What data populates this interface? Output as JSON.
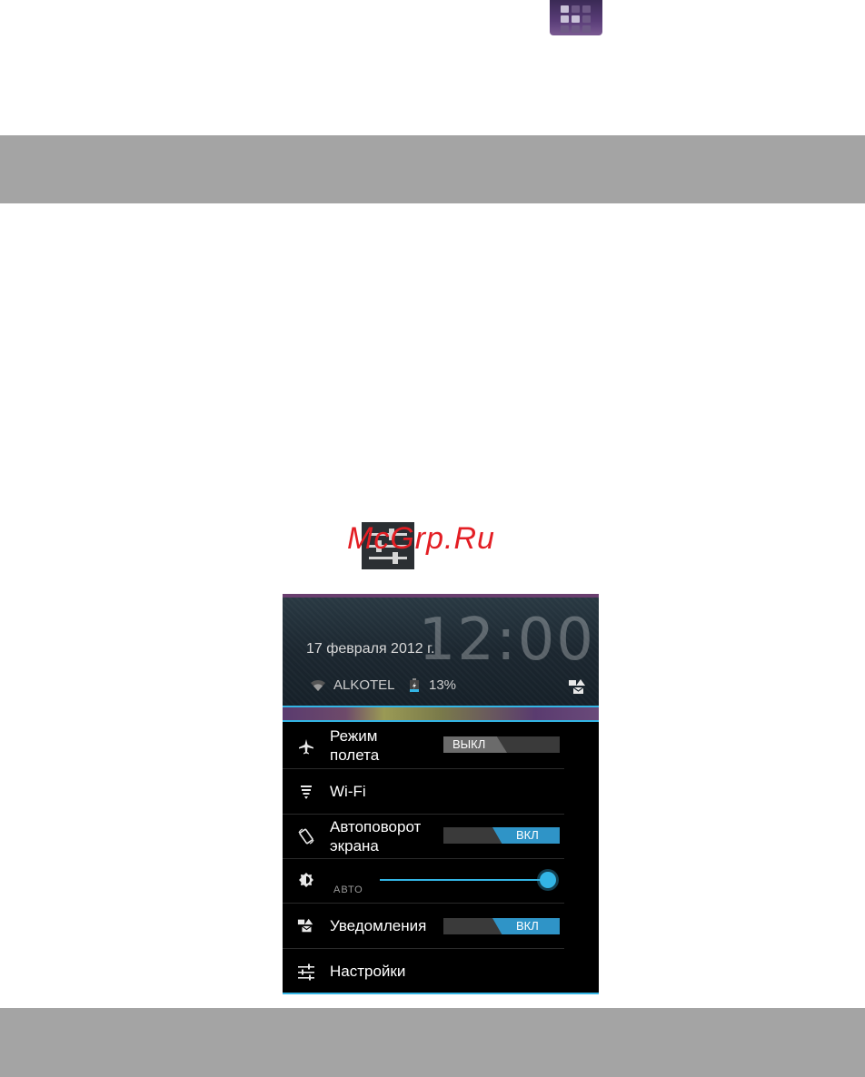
{
  "watermark": "McGrp.Ru",
  "icons": {
    "app_grid": "app-grid-icon",
    "settings": "quick-settings-icon"
  },
  "colors": {
    "accent": "#33b5e5",
    "toggle_on": "#2f94c7",
    "watermark": "#e31e24",
    "band": "#a4a4a4"
  },
  "phone": {
    "header": {
      "clock": "12:00",
      "date": "17 февраля 2012 г.",
      "network": "ALKOTEL",
      "battery": "13%"
    },
    "quick_settings": {
      "airplane": {
        "label_line1": "Режим",
        "label_line2": "полета",
        "state": "ВЫКЛ",
        "on": false
      },
      "wifi": {
        "label": "Wi-Fi"
      },
      "autorotate": {
        "label_line1": "Автоповорот",
        "label_line2": "экрана",
        "state": "ВКЛ",
        "on": true
      },
      "brightness": {
        "auto_label": "АВТО",
        "level": 1.0
      },
      "notifications": {
        "label": "Уведомления",
        "state": "ВКЛ",
        "on": true
      },
      "settings": {
        "label": "Настройки"
      }
    }
  }
}
